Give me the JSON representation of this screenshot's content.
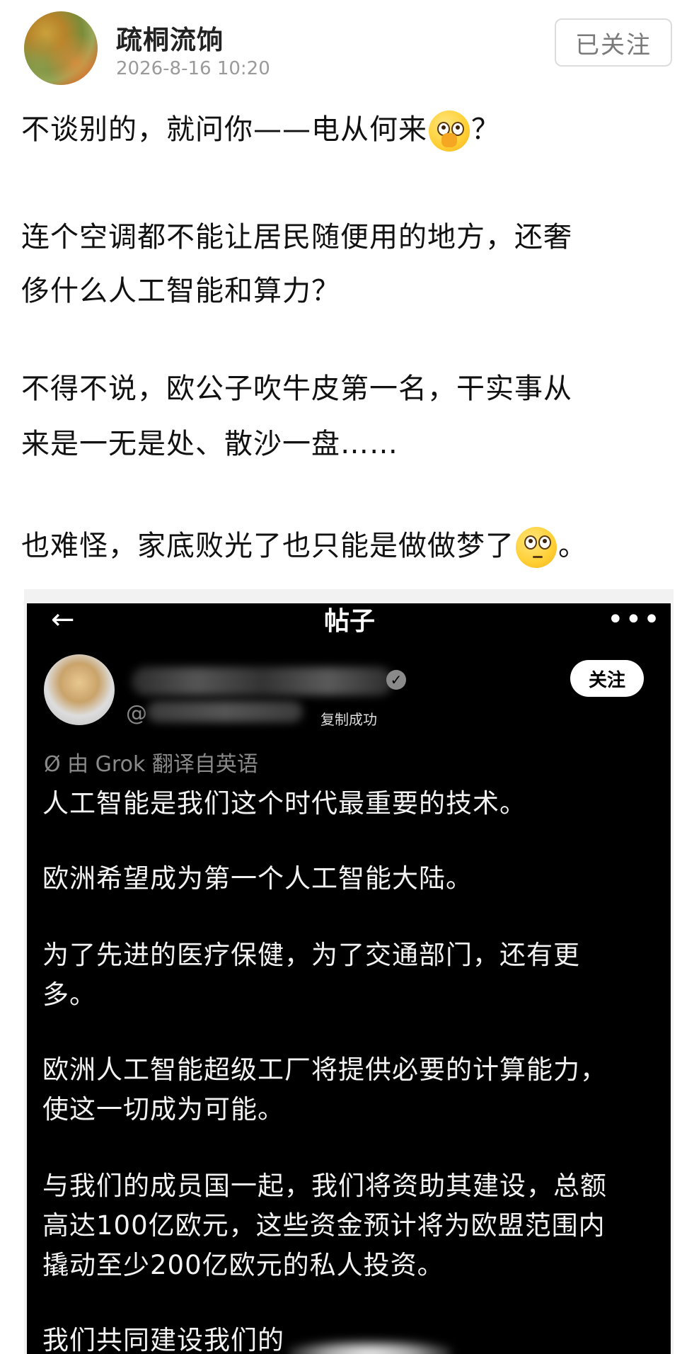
{
  "header": {
    "username": "疏桐流饷",
    "timestamp": "2026-8-16 10:20",
    "follow_label": "已关注"
  },
  "post": {
    "lines": [
      "不谈别的，就问你——电从何来",
      "？",
      "连个空调都不能让居民随便用的地方，还奢",
      "侈什么人工智能和算力？",
      "不得不说，欧公子吹牛皮第一名，干实事从",
      "来是一无是处、散沙一盘……",
      "也难怪，家底败光了也只能是做做梦了",
      "。"
    ],
    "emojis": [
      "shushing-face-emoji",
      "eye-roll-face-emoji"
    ]
  },
  "embedded": {
    "back_icon": "←",
    "title": "帖子",
    "more_icon": "•••",
    "at_prefix": "@",
    "verified_icon": "✓",
    "copied_toast": "复制成功",
    "follow_label": "关注",
    "translated_note": "Ø 由 Grok 翻译自英语",
    "lines": [
      "人工智能是我们这个时代最重要的技术。",
      "欧洲希望成为第一个人工智能大陆。",
      "为了先进的医疗保健，为了交通部门，还有更",
      "多。",
      "欧洲人工智能超级工厂将提供必要的计算能力，",
      "使这一切成为可能。",
      "与我们的成员国一起，我们将资助其建设，总额",
      "高达100亿欧元，这些资金预计将为欧盟范围内",
      "撬动至少200亿欧元的私人投资。",
      "我们共同建设我们的"
    ]
  }
}
